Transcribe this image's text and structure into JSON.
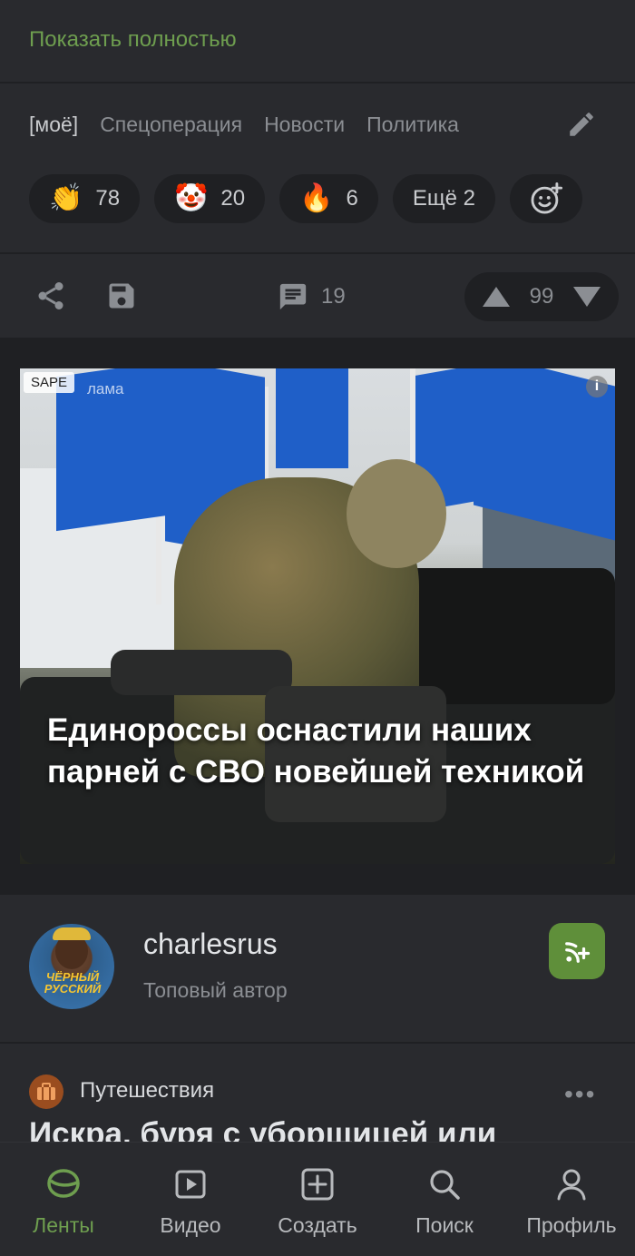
{
  "post": {
    "show_full": "Показать полностью",
    "tags": [
      "[моё]",
      "Спецоперация",
      "Новости",
      "Политика"
    ],
    "reactions": [
      {
        "emoji": "👏",
        "count": "78"
      },
      {
        "emoji": "🤡",
        "count": "20"
      },
      {
        "emoji": "🔥",
        "count": "6"
      }
    ],
    "more_reactions": "Ещё 2",
    "comments_count": "19",
    "rating": "99"
  },
  "ad": {
    "label": "SAPE",
    "label_ghost": "лама",
    "info": "i",
    "title": "Единороссы оснастили наших парней с СВО новейшей техникой",
    "flag_colors": [
      "#1f5fc8"
    ]
  },
  "author": {
    "name": "charlesrus",
    "subtitle": "Топовый автор",
    "avatar_text": "ЧЁРНЫЙ РУССКИЙ"
  },
  "next_post": {
    "category": "Путешествия",
    "title": "Искра, буря с уборщицей или"
  },
  "nav": {
    "items": [
      {
        "label": "Ленты",
        "icon": "feeds-icon",
        "active": true
      },
      {
        "label": "Видео",
        "icon": "video-icon"
      },
      {
        "label": "Создать",
        "icon": "create-icon"
      },
      {
        "label": "Поиск",
        "icon": "search-icon"
      },
      {
        "label": "Профиль",
        "icon": "profile-icon"
      }
    ]
  },
  "colors": {
    "accent": "#6e9e4f",
    "background": "#1f2023",
    "card": "#292a2e"
  }
}
